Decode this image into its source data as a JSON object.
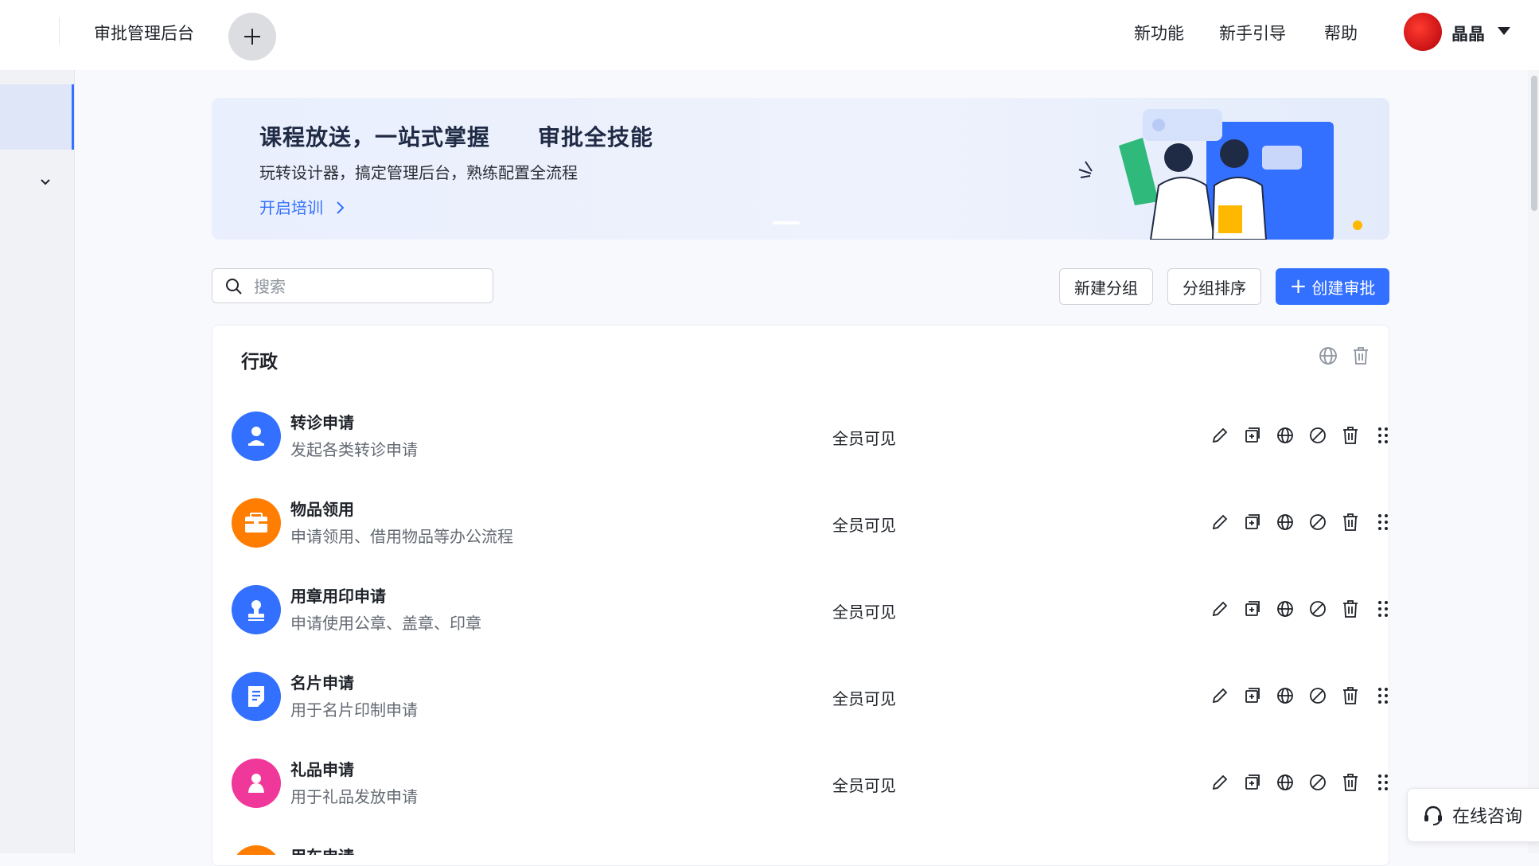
{
  "header": {
    "app_title": "审批管理后台",
    "nav": [
      "新功能",
      "新手引导",
      "帮助"
    ],
    "user_name": "晶晶"
  },
  "banner": {
    "title_part1": "课程放送，一站式掌握",
    "title_part2": "审批全技能",
    "subtitle": "玩转设计器，搞定管理后台，熟练配置全流程",
    "link": "开启培训"
  },
  "toolbar": {
    "search_placeholder": "搜索",
    "new_group": "新建分组",
    "sort_groups": "分组排序",
    "create_approval": "创建审批"
  },
  "group": {
    "title": "行政",
    "items": [
      {
        "name": "转诊申请",
        "desc": "发起各类转诊申请",
        "visibility": "全员可见",
        "color": "#3370ff",
        "icon": "person-stamp-icon"
      },
      {
        "name": "物品领用",
        "desc": "申请领用、借用物品等办公流程",
        "visibility": "全员可见",
        "color": "#ff7d00",
        "icon": "box-icon"
      },
      {
        "name": "用章用印申请",
        "desc": "申请使用公章、盖章、印章",
        "visibility": "全员可见",
        "color": "#3370ff",
        "icon": "stamp-icon"
      },
      {
        "name": "名片申请",
        "desc": "用于名片印制申请",
        "visibility": "全员可见",
        "color": "#3370ff",
        "icon": "document-icon"
      },
      {
        "name": "礼品申请",
        "desc": "用于礼品发放申请",
        "visibility": "全员可见",
        "color": "#f0379a",
        "icon": "gift-icon"
      },
      {
        "name": "用车申请",
        "desc": "",
        "visibility": "",
        "color": "#ff7d00",
        "icon": "car-icon"
      }
    ]
  },
  "consult": {
    "label": "在线咨询"
  },
  "colors": {
    "accent": "#3370ff"
  }
}
